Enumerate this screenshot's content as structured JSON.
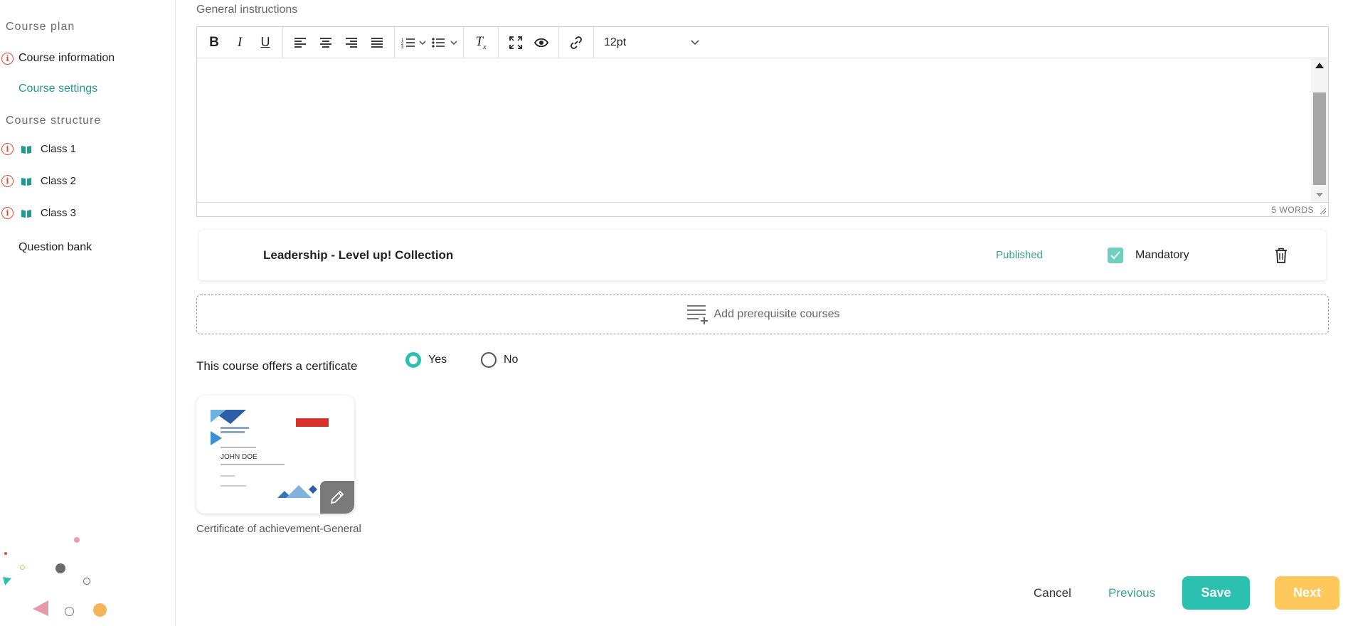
{
  "sidebar": {
    "course_plan_heading": "Course plan",
    "course_information": "Course information",
    "course_settings": "Course settings",
    "course_structure_heading": "Course structure",
    "classes": [
      "Class 1",
      "Class 2",
      "Class 3"
    ],
    "question_bank": "Question bank"
  },
  "editor": {
    "label": "General instructions",
    "font_size": "12pt",
    "word_count": "5 WORDS",
    "toolbar_icons": [
      "bold-icon",
      "italic-icon",
      "underline-icon",
      "align-left-icon",
      "align-center-icon",
      "align-right-icon",
      "justify-icon",
      "numbered-list-icon",
      "bullet-list-icon",
      "clear-format-icon",
      "fullscreen-icon",
      "preview-icon",
      "link-icon"
    ]
  },
  "prerequisite": {
    "title": "Leadership - Level up! Collection",
    "status": "Published",
    "mandatory_label": "Mandatory",
    "mandatory_checked": true,
    "add_label": "Add prerequisite courses"
  },
  "certificate": {
    "question": "This course offers a certificate",
    "yes_label": "Yes",
    "no_label": "No",
    "selected": "Yes",
    "name": "Certificate of achievement-General",
    "preview_name": "JOHN DOE"
  },
  "actions": {
    "cancel": "Cancel",
    "previous": "Previous",
    "save": "Save",
    "next": "Next"
  },
  "colors": {
    "accent": "#2cc0b0",
    "next": "#ffc85c",
    "info": "#e24b3b",
    "published": "#3aa08d"
  }
}
